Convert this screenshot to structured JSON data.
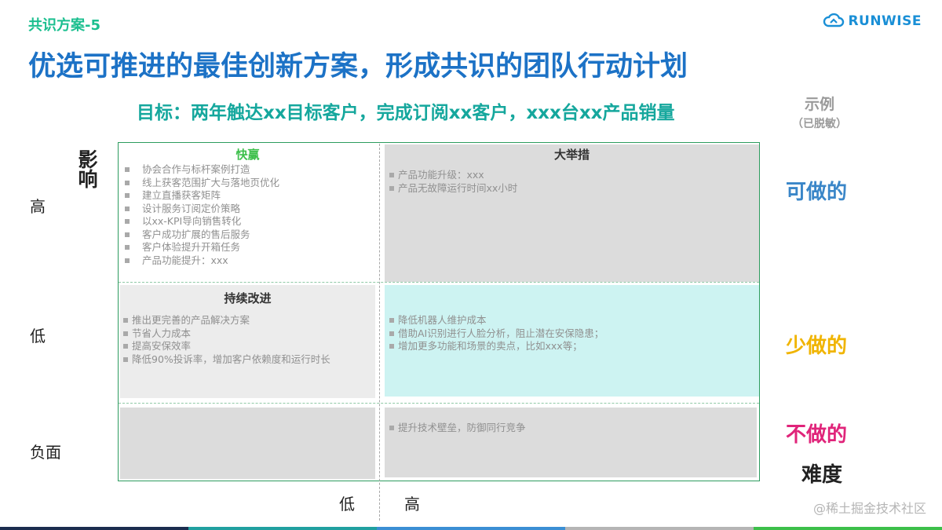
{
  "slide_tag": "共识方案-5",
  "brand": {
    "logo_text": "RUNWISE",
    "color": "#1a8fd6"
  },
  "title": "优选可推进的最佳创新方案，形成共识的团队行动计划",
  "goal": "目标：两年触达xx目标客户，完成订阅xx客户，xxx台xx产品销量",
  "example": {
    "label": "示例",
    "note": "（已脱敏）"
  },
  "axes": {
    "y_title": "影响",
    "y_levels": [
      "高",
      "低",
      "负面"
    ],
    "x_levels": [
      "低",
      "高"
    ],
    "x_title": "难度"
  },
  "quadrants": {
    "quick_win": {
      "title": "快赢",
      "items": [
        "协会合作与标杆案例打造",
        "线上获客范围扩大与落地页优化",
        "建立直播获客矩阵",
        "设计服务订阅定价策略",
        "以xx-KPI导向销售转化",
        "客户成功扩展的售后服务",
        "客户体验提升开箱任务",
        "产品功能提升：xxx"
      ]
    },
    "big_bet": {
      "title": "大举措",
      "items": [
        "产品功能升级：xxx",
        "产品无故障运行时间xx小时"
      ]
    },
    "improve": {
      "title": "持续改进",
      "items": [
        "推出更完善的产品解决方案",
        "节省人力成本",
        "提高安保效率",
        "降低90%投诉率，增加客户依赖度和运行时长"
      ]
    },
    "low_high": {
      "items": [
        "降低机器人维护成本",
        "借助AI识别进行人脸分析，阻止潜在安保隐患；",
        "增加更多功能和场景的卖点，比如xxx等；"
      ]
    },
    "negative_high": {
      "items": [
        "提升技术壁垒，防御同行竞争"
      ]
    }
  },
  "side_labels": {
    "do": {
      "text": "可做的",
      "color": "#3a86c8"
    },
    "less": {
      "text": "少做的",
      "color": "#f0b400"
    },
    "dont": {
      "text": "不做的",
      "color": "#e0247a"
    }
  },
  "watermark": "@稀土掘金技术社区",
  "bottom_bar_colors": [
    "#1b2d4f",
    "#20a0a0",
    "#3b8fd4",
    "#b5b5b5",
    "#3cbf4a"
  ]
}
